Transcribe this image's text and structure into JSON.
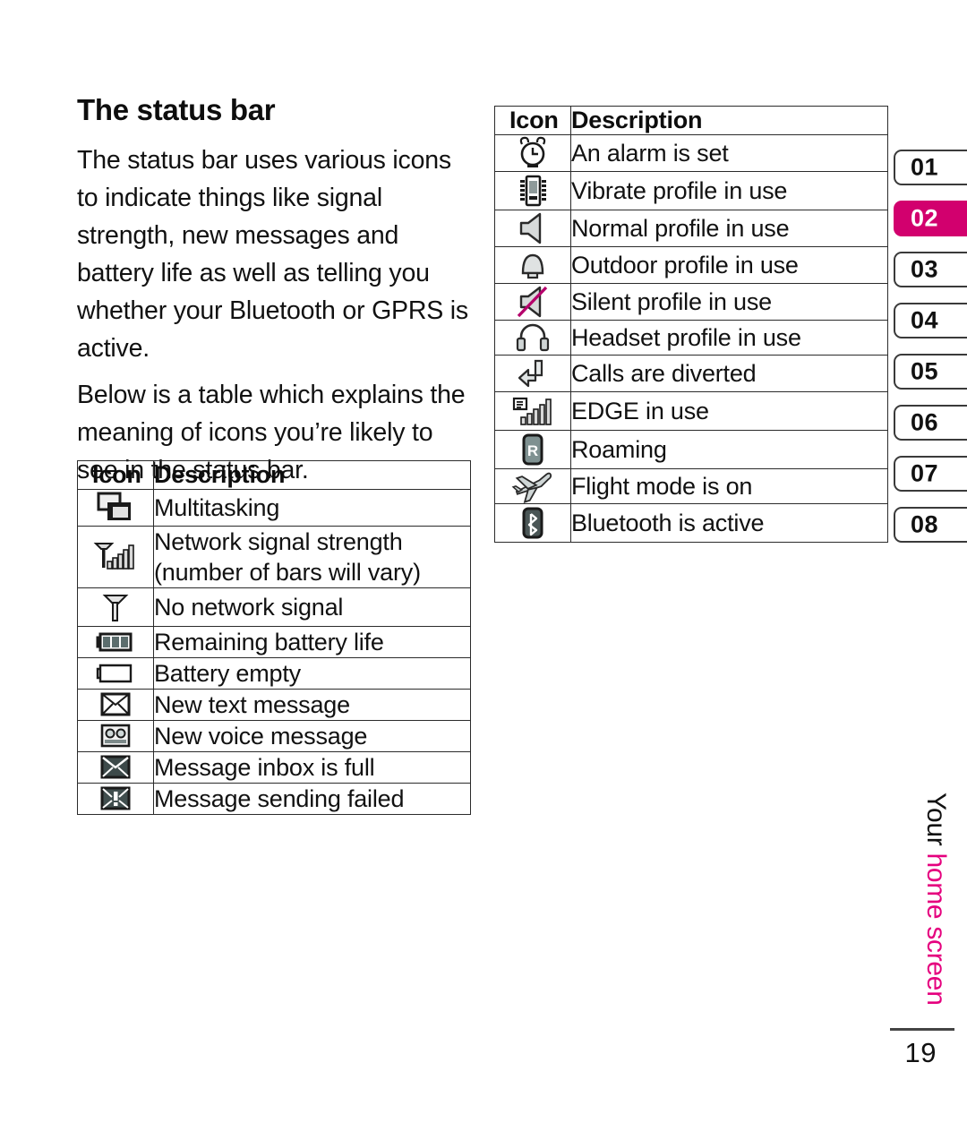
{
  "page": {
    "title": "The status bar",
    "number": "19",
    "side_label_black": "Your ",
    "side_label_pink": "home screen"
  },
  "intro": {
    "paragraphs": [
      "The status bar uses various icons to indicate things like signal strength, new messages and battery life as well as telling you whether your Bluetooth or GPRS is active.",
      "Below is a table which explains the meaning of icons you’re likely to see in the status bar."
    ]
  },
  "left_table": {
    "headers": [
      "Icon",
      "Description"
    ],
    "rows": [
      {
        "icon": "multitasking-icon",
        "description": "Multitasking"
      },
      {
        "icon": "signal-bars-icon",
        "description": "Network signal strength (number of bars will vary)"
      },
      {
        "icon": "no-signal-icon",
        "description": "No network signal"
      },
      {
        "icon": "battery-full-icon",
        "description": "Remaining battery life"
      },
      {
        "icon": "battery-empty-icon",
        "description": "Battery empty"
      },
      {
        "icon": "new-text-message-icon",
        "description": "New text message"
      },
      {
        "icon": "new-voice-message-icon",
        "description": "New voice message"
      },
      {
        "icon": "inbox-full-icon",
        "description": "Message inbox is full"
      },
      {
        "icon": "message-failed-icon",
        "description": "Message sending failed"
      }
    ]
  },
  "right_table": {
    "headers": [
      "Icon",
      "Description"
    ],
    "rows": [
      {
        "icon": "alarm-clock-icon",
        "description": "An alarm is set"
      },
      {
        "icon": "vibrate-icon",
        "description": "Vibrate profile in use"
      },
      {
        "icon": "speaker-icon",
        "description": "Normal profile in use"
      },
      {
        "icon": "bell-icon",
        "description": "Outdoor profile in use"
      },
      {
        "icon": "speaker-muted-icon",
        "description": "Silent profile in use"
      },
      {
        "icon": "headset-icon",
        "description": "Headset profile in use"
      },
      {
        "icon": "call-divert-icon",
        "description": "Calls are diverted"
      },
      {
        "icon": "edge-signal-icon",
        "description": "EDGE in use"
      },
      {
        "icon": "roaming-icon",
        "description": "Roaming"
      },
      {
        "icon": "flight-mode-icon",
        "description": "Flight mode is on"
      },
      {
        "icon": "bluetooth-icon",
        "description": "Bluetooth is active"
      }
    ]
  },
  "tabs": {
    "active_index": 1,
    "items": [
      "01",
      "02",
      "03",
      "04",
      "05",
      "06",
      "07",
      "08"
    ]
  },
  "colors": {
    "accent_magenta": "#D2006E",
    "side_label_pink": "#E5007E",
    "border": "#2b2b2b",
    "text": "#111111"
  }
}
